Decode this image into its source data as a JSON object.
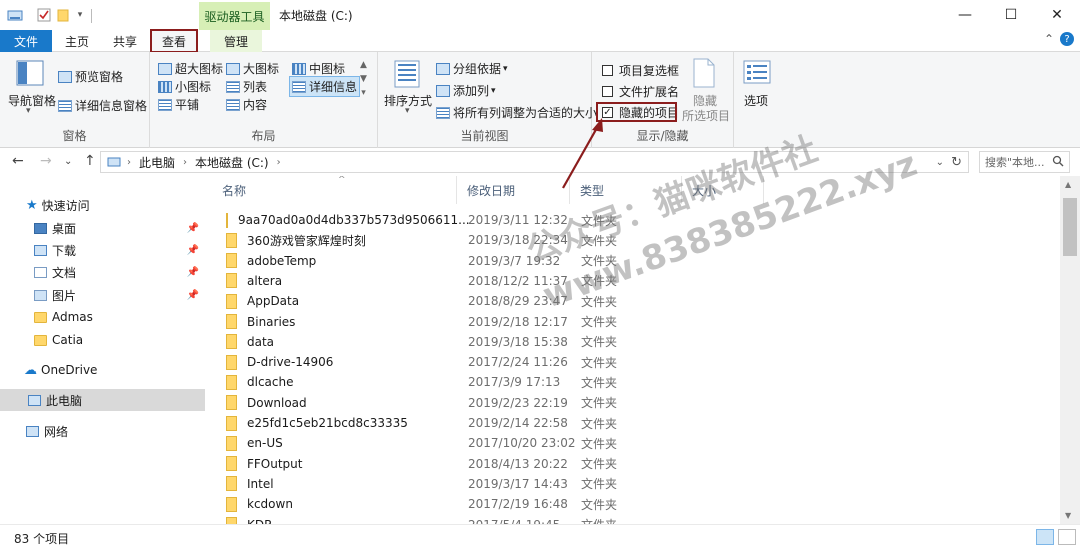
{
  "window": {
    "title": "本地磁盘 (C:)",
    "context_tab_group": "驱动器工具",
    "controls": [
      "—",
      "☐",
      "✕"
    ]
  },
  "tabs": {
    "file": "文件",
    "home": "主页",
    "share": "共享",
    "view": "查看",
    "manage": "管理"
  },
  "ribbon": {
    "panes": {
      "label": "窗格",
      "navigation_pane": "导航窗格",
      "preview_pane": "预览窗格",
      "details_pane": "详细信息窗格"
    },
    "layout": {
      "label": "布局",
      "extra_large_icons": "超大图标",
      "large_icons": "大图标",
      "medium_icons": "中图标",
      "small_icons": "小图标",
      "list": "列表",
      "details": "详细信息",
      "tiles": "平铺",
      "content": "内容"
    },
    "current_view": {
      "label": "当前视图",
      "sort_by": "排序方式",
      "group_by": "分组依据",
      "add_columns": "添加列",
      "size_all_columns": "将所有列调整为合适的大小"
    },
    "show_hide": {
      "label": "显示/隐藏",
      "item_checkboxes": "项目复选框",
      "file_extensions": "文件扩展名",
      "hidden_items": "隐藏的项目",
      "hidden_items_checked": true,
      "hide_selected_line1": "隐藏",
      "hide_selected_line2": "所选项目"
    },
    "options": "选项"
  },
  "address": {
    "path": [
      "此电脑",
      "本地磁盘 (C:)"
    ],
    "search_placeholder": "搜索\"本地..."
  },
  "nav_pane": {
    "quick_access": "快速访问",
    "items": [
      {
        "label": "桌面",
        "pinned": true
      },
      {
        "label": "下载",
        "pinned": true
      },
      {
        "label": "文档",
        "pinned": true
      },
      {
        "label": "图片",
        "pinned": true
      },
      {
        "label": "Admas",
        "pinned": false
      },
      {
        "label": "Catia",
        "pinned": false
      }
    ],
    "onedrive": "OneDrive",
    "this_pc": "此电脑",
    "network": "网络"
  },
  "columns": {
    "name": "名称",
    "date": "修改日期",
    "type": "类型",
    "size": "大小"
  },
  "files": [
    {
      "name": "9aa70ad0a0d4db337b573d9506611...",
      "date": "2019/3/11 12:32",
      "type": "文件夹"
    },
    {
      "name": "360游戏管家辉煌时刻",
      "date": "2019/3/18 22:34",
      "type": "文件夹"
    },
    {
      "name": "adobeTemp",
      "date": "2019/3/7 19:32",
      "type": "文件夹"
    },
    {
      "name": "altera",
      "date": "2018/12/2 11:37",
      "type": "文件夹"
    },
    {
      "name": "AppData",
      "date": "2018/8/29 23:47",
      "type": "文件夹"
    },
    {
      "name": "Binaries",
      "date": "2019/2/18 12:17",
      "type": "文件夹"
    },
    {
      "name": "data",
      "date": "2019/3/18 15:38",
      "type": "文件夹"
    },
    {
      "name": "D-drive-14906",
      "date": "2017/2/24 11:26",
      "type": "文件夹"
    },
    {
      "name": "dlcache",
      "date": "2017/3/9 17:13",
      "type": "文件夹"
    },
    {
      "name": "Download",
      "date": "2019/2/23 22:19",
      "type": "文件夹"
    },
    {
      "name": "e25fd1c5eb21bcd8c33335",
      "date": "2019/2/14 22:58",
      "type": "文件夹"
    },
    {
      "name": "en-US",
      "date": "2017/10/20 23:02",
      "type": "文件夹"
    },
    {
      "name": "FFOutput",
      "date": "2018/4/13 20:22",
      "type": "文件夹"
    },
    {
      "name": "Intel",
      "date": "2019/3/17 14:43",
      "type": "文件夹"
    },
    {
      "name": "kcdown",
      "date": "2017/2/19 16:48",
      "type": "文件夹"
    },
    {
      "name": "KDR",
      "date": "2017/5/4 19:45",
      "type": "文件夹"
    }
  ],
  "status": {
    "item_count": "83 个项目"
  },
  "watermark": {
    "line1": "公众号：猫咪软件社",
    "line2": "www.838385222.xyz"
  },
  "colors": {
    "file_tab": "#1979ca",
    "context_tab": "#d7efb6",
    "highlight_box": "#8b1d1d",
    "folder": "#ffd76b"
  }
}
